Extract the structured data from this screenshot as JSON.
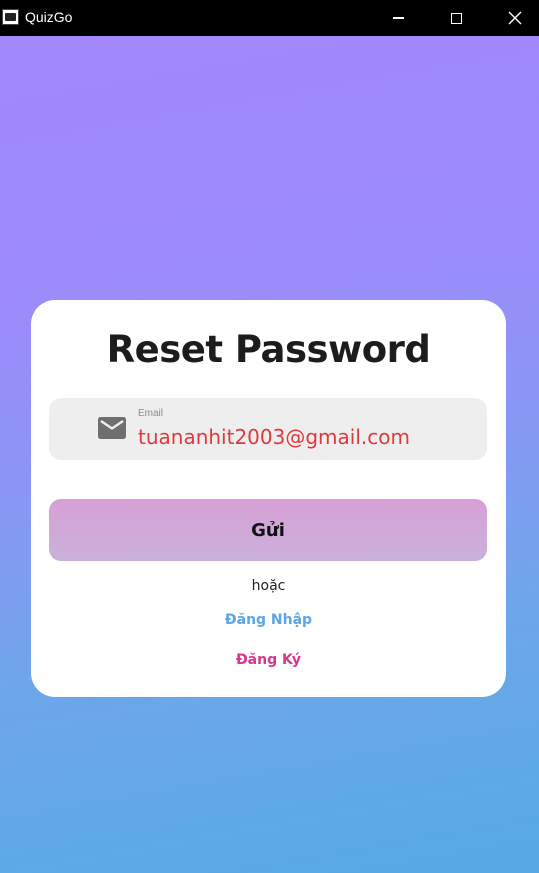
{
  "window": {
    "title": "QuizGo",
    "icon": "book-app-icon",
    "controls": [
      "minimize-icon",
      "maximize-icon",
      "close-icon"
    ]
  },
  "form": {
    "heading": "Reset Password",
    "email": {
      "label": "Email",
      "value": "tuananhit2003@gmail.com",
      "icon": "mail-icon"
    },
    "submit_label": "Gửi",
    "separator": "hoặc",
    "login_link": "Đăng Nhập",
    "register_link": "Đăng Ký"
  },
  "colors": {
    "email_text": "#e0393b",
    "login_link": "#5aa6e8",
    "register_link": "#d8358f",
    "card": "#ffffff",
    "field_bg": "#eeeeee"
  }
}
